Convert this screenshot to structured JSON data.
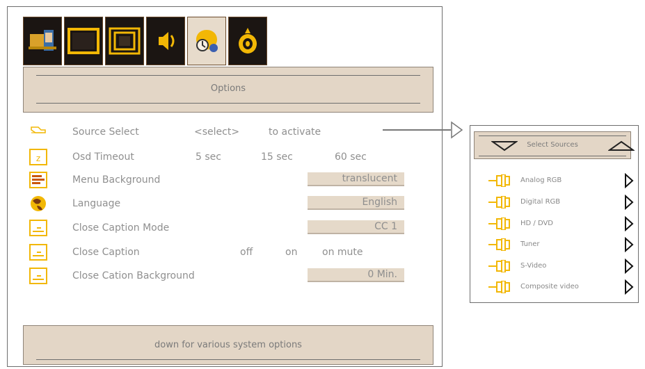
{
  "tabs": [
    {
      "icon": "picture-source-icon",
      "active": false
    },
    {
      "icon": "display-icon",
      "active": false
    },
    {
      "icon": "screen-adjust-icon",
      "active": false
    },
    {
      "icon": "audio-icon",
      "active": false
    },
    {
      "icon": "options-icon",
      "active": true
    },
    {
      "icon": "setup-icon",
      "active": false
    }
  ],
  "header": {
    "title": "Options"
  },
  "rows": {
    "source_select": {
      "label": "Source Select",
      "v1": "<select>",
      "v2": "to activate"
    },
    "osd_timeout": {
      "label": "Osd Timeout",
      "v1": "5 sec",
      "v2": "15 sec",
      "v3": "60 sec"
    },
    "menu_background": {
      "label": "Menu Background",
      "value": "translucent"
    },
    "language": {
      "label": "Language",
      "value": "English"
    },
    "cc_mode": {
      "label": "Close Caption Mode",
      "value": "CC 1"
    },
    "close_caption": {
      "label": "Close Caption",
      "v1": "off",
      "v2": "on",
      "v3": "on mute"
    },
    "cc_background": {
      "label": "Close Cation Background",
      "value": "0 Min."
    }
  },
  "footer": {
    "text": "down for various system options"
  },
  "sources": {
    "title": "Select Sources",
    "items": [
      "Analog RGB",
      "Digital RGB",
      "HD / DVD",
      "Tuner",
      "S-Video",
      "Composite video"
    ]
  },
  "colors": {
    "accent": "#f2b705",
    "panel": "#e3d6c6",
    "tab_bg": "#1b1512"
  }
}
